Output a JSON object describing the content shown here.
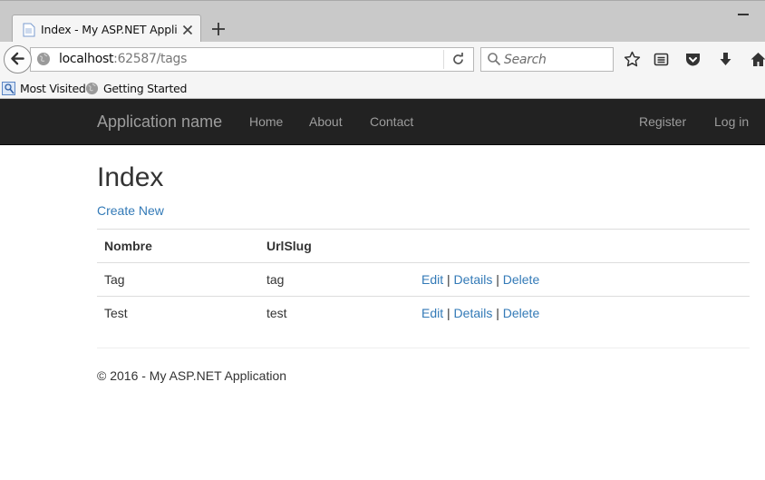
{
  "browser": {
    "tab_title": "Index - My ASP.NET Appli…",
    "url_host": "localhost",
    "url_rest": ":62587/tags",
    "search_placeholder": "Search",
    "bookmarks": [
      {
        "label": "Most Visited"
      },
      {
        "label": "Getting Started"
      }
    ]
  },
  "site": {
    "brand": "Application name",
    "nav": [
      {
        "label": "Home"
      },
      {
        "label": "About"
      },
      {
        "label": "Contact"
      }
    ],
    "account": [
      {
        "label": "Register"
      },
      {
        "label": "Log in"
      }
    ]
  },
  "main": {
    "title": "Index",
    "create_new": "Create New",
    "table": {
      "headers": [
        "Nombre",
        "UrlSlug",
        ""
      ],
      "rows": [
        {
          "nombre": "Tag",
          "slug": "tag",
          "edit": "Edit",
          "details": "Details",
          "delete": "Delete"
        },
        {
          "nombre": "Test",
          "slug": "test",
          "edit": "Edit",
          "details": "Details",
          "delete": "Delete"
        }
      ],
      "separator": "|"
    }
  },
  "footer": {
    "text": "© 2016 - My ASP.NET Application"
  }
}
